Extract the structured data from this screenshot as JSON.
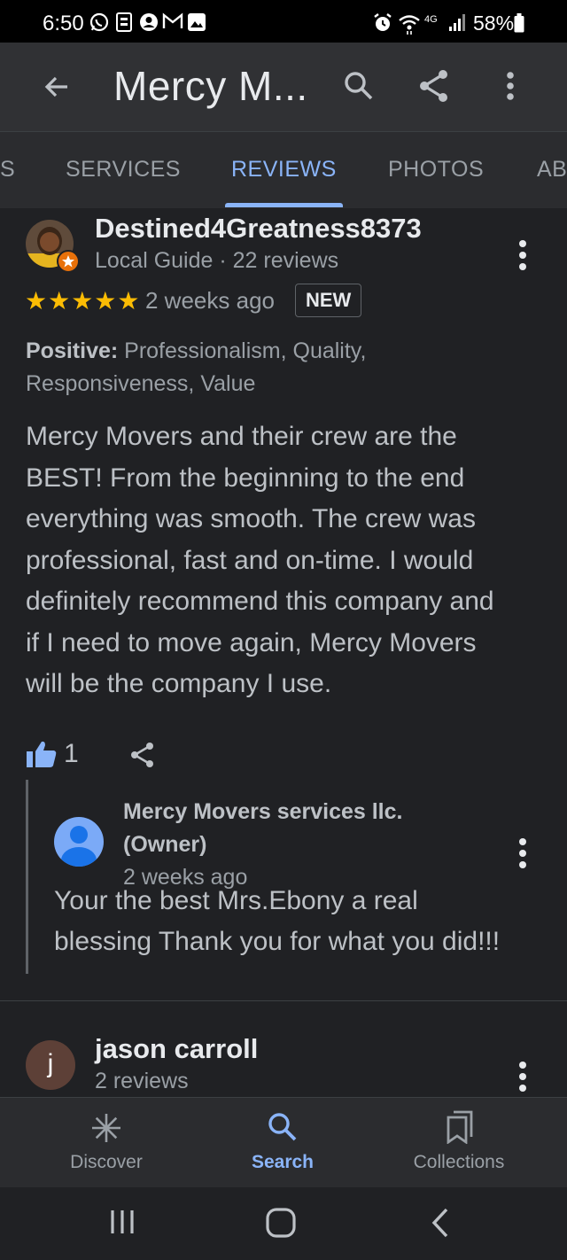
{
  "status_bar": {
    "time": "6:50",
    "network": "4G",
    "battery": "58%"
  },
  "app_bar": {
    "title": "Mercy M..."
  },
  "tabs": [
    {
      "label": "S"
    },
    {
      "label": "SERVICES"
    },
    {
      "label": "REVIEWS",
      "active": true
    },
    {
      "label": "PHOTOS"
    },
    {
      "label": "AB"
    }
  ],
  "review": {
    "reviewer_name": "Destined4Greatness8373",
    "reviewer_meta": "Local Guide · 22 reviews",
    "stars": "★★★★★",
    "rating": 5,
    "time_ago": "2 weeks ago",
    "badge": "NEW",
    "positive_label": "Positive:",
    "positive_values": "Professionalism, Quality,",
    "positive_values_2": "Responsiveness, Value",
    "text_lines": [
      "Mercy Movers and their crew are the",
      "BEST! From the beginning to the end",
      "everything was smooth. The crew was",
      "professional, fast and on-time. I would",
      "definitely recommend this company and",
      "if I need to move again, Mercy Movers",
      "will be the company I use."
    ],
    "like_count": "1"
  },
  "owner_reply": {
    "name_line1": "Mercy Movers services llc.",
    "name_line2": "(Owner)",
    "time_ago": "2 weeks ago",
    "text_line1": "Your the best Mrs.Ebony a real",
    "text_line2": "blessing Thank you for what you did!!!"
  },
  "next_review": {
    "avatar_letter": "j",
    "reviewer_name": "jason carroll",
    "reviewer_meta": "2 reviews"
  },
  "bottom_nav": {
    "discover": "Discover",
    "search": "Search",
    "collections": "Collections"
  },
  "colors": {
    "accent": "#8ab4f8",
    "star": "#fbbc04",
    "like": "#8ab4f8",
    "background": "#202124"
  }
}
